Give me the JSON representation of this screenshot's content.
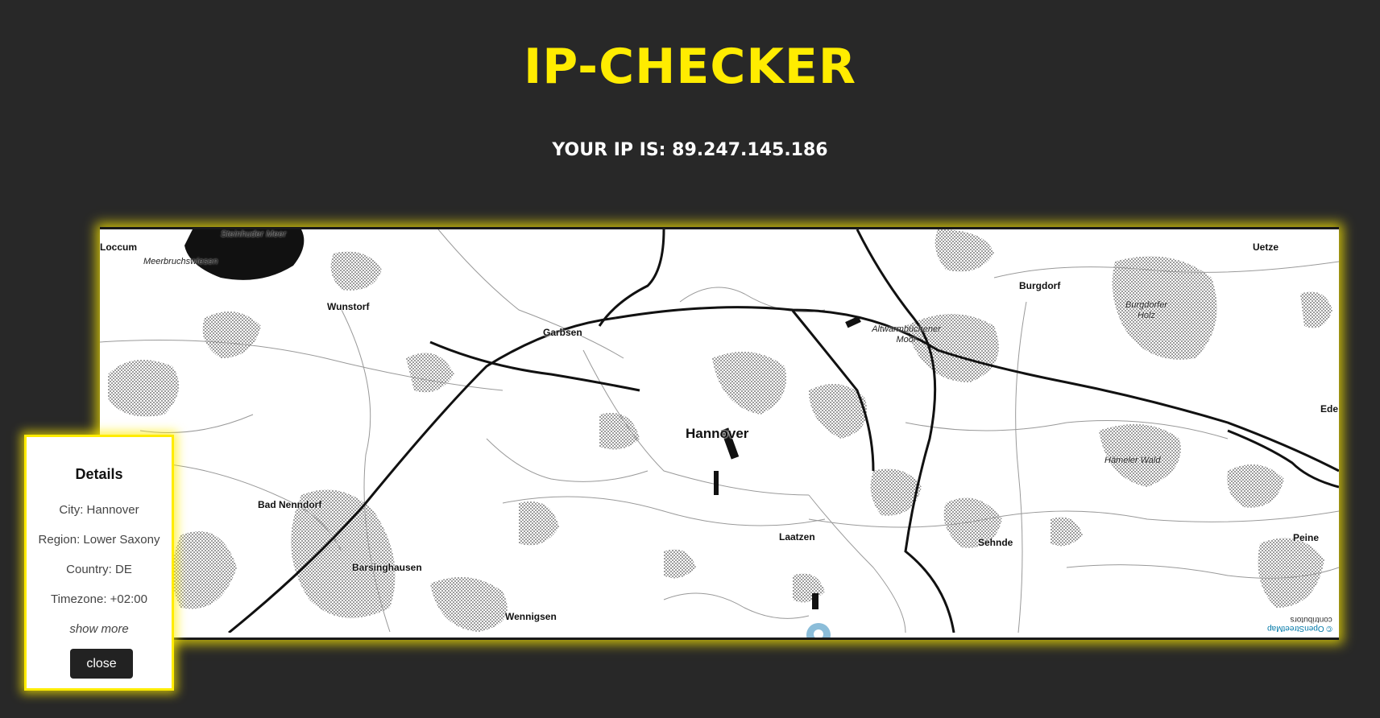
{
  "header": {
    "title": "IP-CHECKER",
    "ip_text": "YOUR IP IS: 89.247.145.186"
  },
  "map": {
    "labels": {
      "loccum": "Loccum",
      "steinhuder_meer": "Steinhuder Meer",
      "meerbruchswiesen": "Meerbruchswiesen",
      "wunstorf": "Wunstorf",
      "garbsen": "Garbsen",
      "hannover": "Hannover",
      "bad_nenndorf": "Bad Nenndorf",
      "barsinghausen": "Barsinghausen",
      "wennigsen": "Wennigsen",
      "laatzen": "Laatzen",
      "sehnde": "Sehnde",
      "peine": "Peine",
      "burgdorf": "Burgdorf",
      "burgdorfer_holz": "Burgdorfer Holz",
      "altwarmbuchener_moor": "Altwarmbüchener Moor",
      "haemeler_wald": "Hämeler Wald",
      "uetze": "Uetze",
      "ede": "Ede"
    },
    "attribution_osm": "© OpenStreetMap",
    "attribution_contrib": "contributors",
    "marker_icon": "map-pin-icon",
    "marker_color": "#8bbdd9"
  },
  "details": {
    "heading": "Details",
    "city": "City: Hannover",
    "region": "Region: Lower Saxony",
    "country": "Country: DE",
    "timezone": "Timezone: +02:00",
    "show_more": "show more",
    "close_label": "close"
  },
  "colors": {
    "background": "#282828",
    "accent": "#ffec00",
    "map_bg": "#ffffff"
  }
}
